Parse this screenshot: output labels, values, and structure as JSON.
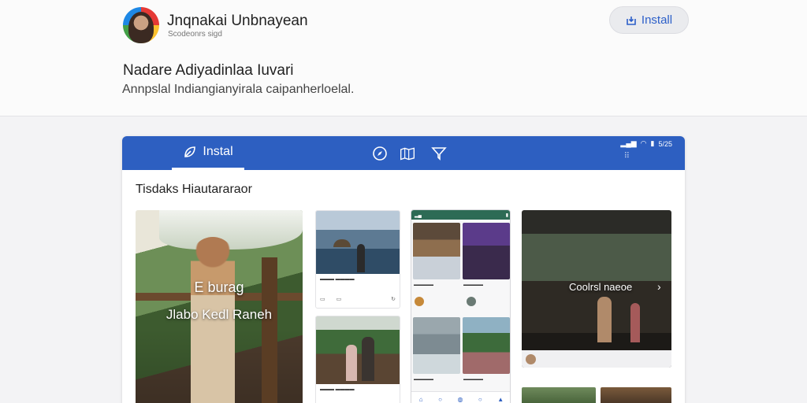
{
  "publisher": {
    "name": "Jnqnakai Unbnayean",
    "subtitle": "Scodeonrs sigd",
    "install_label": "Install"
  },
  "app": {
    "title": "Nadare Adiyadinlaa Iuvari",
    "description": "Annpslal Indiangianyirala caipanherloelal."
  },
  "preview": {
    "tab_label": "Instal",
    "status_time": "5/25",
    "section_title": "Tisdaks Hiautararaor",
    "featured": {
      "line1": "E burag",
      "line2": "Jlabo Kedl Raneh"
    },
    "night_card": {
      "label": "Coolrsl naeoe"
    }
  },
  "colors": {
    "accent": "#2d5fc1",
    "install_text": "#2c5fc9"
  }
}
